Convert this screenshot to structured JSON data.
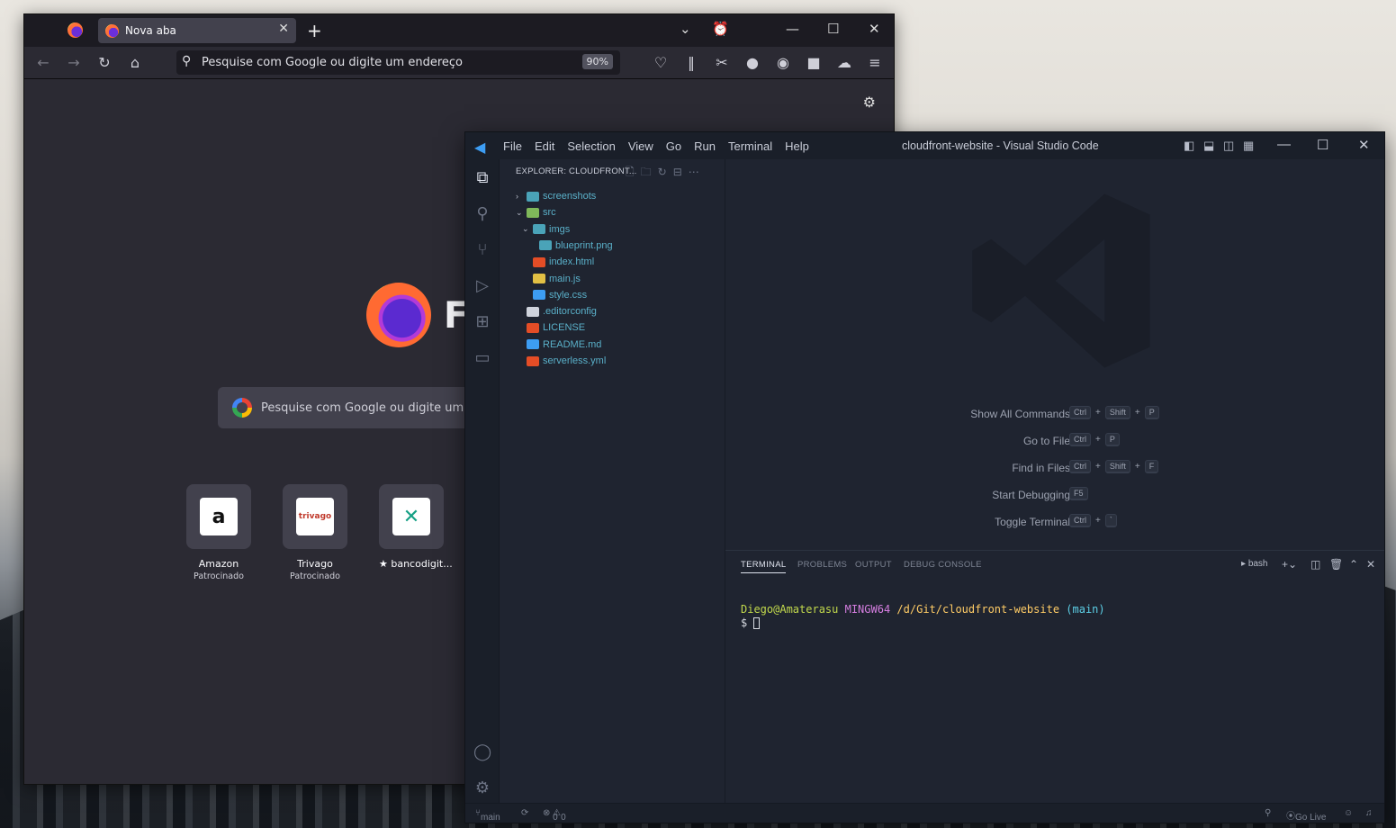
{
  "firefox": {
    "tab": {
      "title": "Nova aba"
    },
    "address": {
      "placeholder": "Pesquise com Google ou digite um endereço",
      "zoom": "90%"
    },
    "brand_text": "Fi",
    "search": {
      "placeholder": "Pesquise com Google ou digite um end"
    },
    "shortcuts": [
      {
        "name": "Amazon",
        "sub": "Patrocinado",
        "glyph": "a"
      },
      {
        "name": "Trivago",
        "sub": "Patrocinado",
        "glyph": "trivago"
      },
      {
        "name": "★ bancodigit...",
        "sub": "",
        "glyph": "✕"
      }
    ]
  },
  "vscode": {
    "menu": [
      "File",
      "Edit",
      "Selection",
      "View",
      "Go",
      "Run",
      "Terminal",
      "Help"
    ],
    "title": "cloudfront-website - Visual Studio Code",
    "explorer": {
      "header": "EXPLORER: CLOUDFRONT...",
      "tree": [
        {
          "label": "screenshots",
          "depth": 0,
          "chev": "›",
          "kind": "folder",
          "color": "#5ab0c9"
        },
        {
          "label": "src",
          "depth": 0,
          "chev": "⌄",
          "kind": "folder-src",
          "color": "#5ab0c9"
        },
        {
          "label": "imgs",
          "depth": 1,
          "chev": "⌄",
          "kind": "folder",
          "color": "#5ab0c9"
        },
        {
          "label": "blueprint.png",
          "depth": 2,
          "chev": "",
          "kind": "image",
          "color": "#5ab0c9"
        },
        {
          "label": "index.html",
          "depth": 1,
          "chev": "",
          "kind": "html",
          "color": "#5ab0c9"
        },
        {
          "label": "main.js",
          "depth": 1,
          "chev": "",
          "kind": "js",
          "color": "#5ab0c9"
        },
        {
          "label": "style.css",
          "depth": 1,
          "chev": "",
          "kind": "css",
          "color": "#5ab0c9"
        },
        {
          "label": ".editorconfig",
          "depth": 0,
          "chev": "",
          "kind": "config",
          "color": "#5ab0c9"
        },
        {
          "label": "LICENSE",
          "depth": 0,
          "chev": "",
          "kind": "license",
          "color": "#5ab0c9"
        },
        {
          "label": "README.md",
          "depth": 0,
          "chev": "",
          "kind": "info",
          "color": "#5ab0c9"
        },
        {
          "label": "serverless.yml",
          "depth": 0,
          "chev": "",
          "kind": "yml",
          "color": "#5ab0c9"
        }
      ]
    },
    "shortcuts": [
      {
        "label": "Show All Commands",
        "keys": [
          "Ctrl",
          "Shift",
          "P"
        ]
      },
      {
        "label": "Go to File",
        "keys": [
          "Ctrl",
          "P"
        ]
      },
      {
        "label": "Find in Files",
        "keys": [
          "Ctrl",
          "Shift",
          "F"
        ]
      },
      {
        "label": "Start Debugging",
        "keys": [
          "F5"
        ]
      },
      {
        "label": "Toggle Terminal",
        "keys": [
          "Ctrl",
          "`"
        ]
      }
    ],
    "panel": {
      "tabs": [
        "TERMINAL",
        "PROBLEMS",
        "OUTPUT",
        "DEBUG CONSOLE"
      ],
      "shell": "bash",
      "prompt_user": "Diego@Amaterasu",
      "prompt_env": "MINGW64",
      "prompt_path": "/d/Git/cloudfront-website",
      "prompt_branch": "(main)",
      "prompt_symbol": "$"
    },
    "status": {
      "branch": "main",
      "errors": "0",
      "warnings": "0",
      "golive": "Go Live"
    }
  },
  "colors": {
    "ff_bg": "#2b2a33",
    "vs_bg": "#1f2430",
    "term_user": "#c2d94c",
    "term_env": "#d57ee0",
    "term_path": "#ffcc66",
    "term_branch": "#5ccfe6",
    "accent": "#3d9df3"
  }
}
